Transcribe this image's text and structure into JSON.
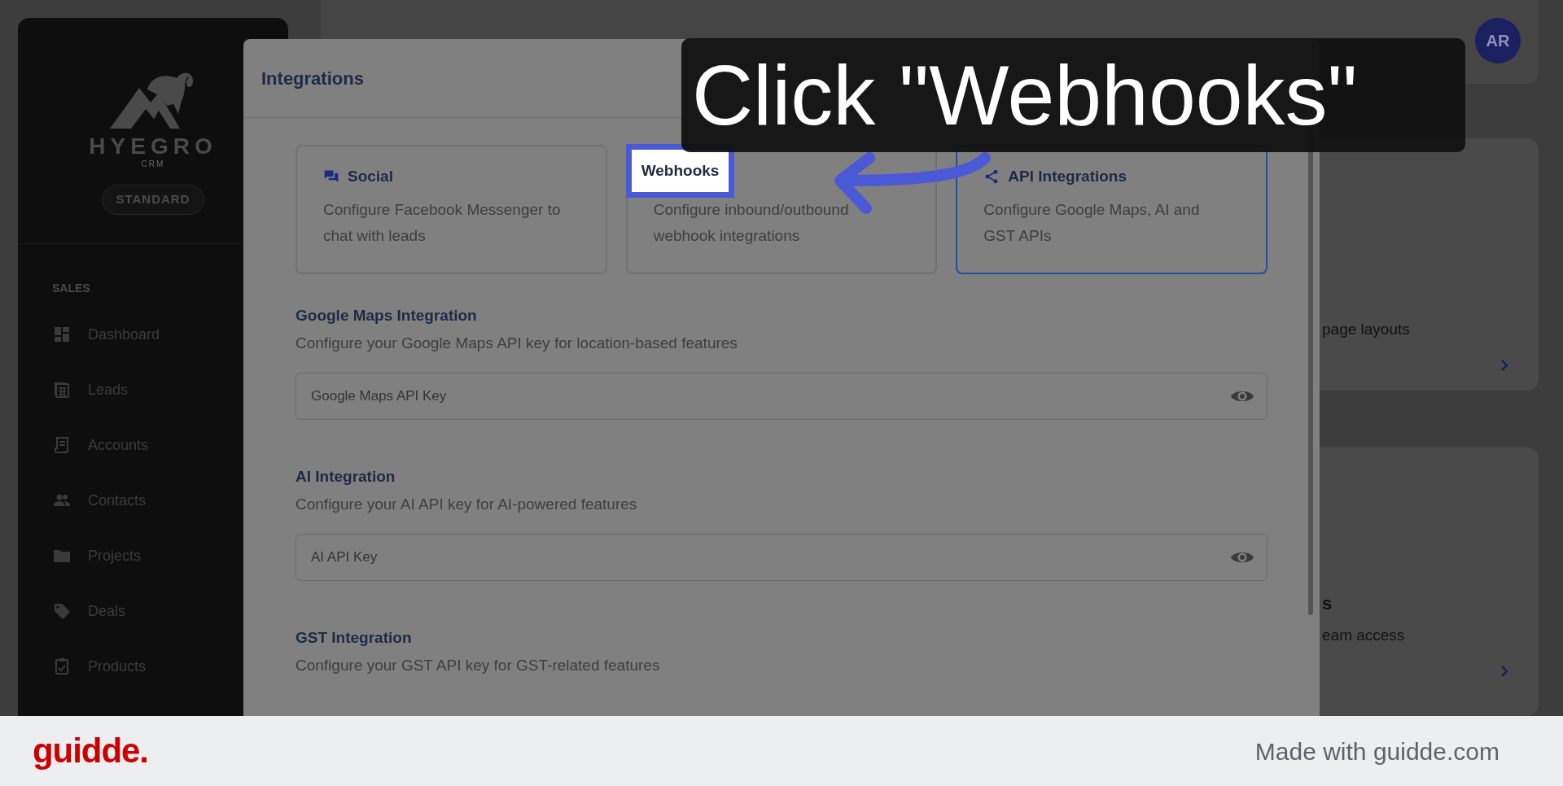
{
  "sidebar": {
    "logo_text": "HYEGRO",
    "logo_subtext": "CRM",
    "plan_badge": "STANDARD",
    "section_label": "SALES",
    "items": [
      {
        "label": "Dashboard",
        "selected": false
      },
      {
        "label": "Leads",
        "selected": false
      },
      {
        "label": "Accounts",
        "selected": false
      },
      {
        "label": "Contacts",
        "selected": false
      },
      {
        "label": "Projects",
        "selected": false
      },
      {
        "label": "Deals",
        "selected": false
      },
      {
        "label": "Products",
        "selected": false
      }
    ]
  },
  "header": {
    "avatar": "AR"
  },
  "background_cards": [
    {
      "text": "page layouts"
    },
    {
      "heading": "s",
      "text": "eam access"
    }
  ],
  "modal": {
    "title": "Integrations",
    "cards": [
      {
        "title": "Social",
        "description": "Configure Facebook Messenger to chat with leads",
        "selected": false,
        "highlighted": false
      },
      {
        "title": "Webhooks",
        "description": "Configure inbound/outbound webhook integrations",
        "selected": false,
        "highlighted": true
      },
      {
        "title": "API Integrations",
        "description": "Configure Google Maps, AI and GST APIs",
        "selected": true,
        "highlighted": false
      }
    ],
    "sections": [
      {
        "title": "Google Maps Integration",
        "description": "Configure your Google Maps API key for location-based features",
        "field": {
          "placeholder": "Google Maps API Key"
        }
      },
      {
        "title": "AI Integration",
        "description": "Configure your AI API key for AI-powered features",
        "field": {
          "placeholder": "AI API Key"
        }
      },
      {
        "title": "GST Integration",
        "description": "Configure your GST API key for GST-related features"
      }
    ]
  },
  "callout": {
    "text": "Click \"Webhooks\""
  },
  "footer": {
    "brand": "guidde.",
    "credit": "Made with guidde.com"
  }
}
